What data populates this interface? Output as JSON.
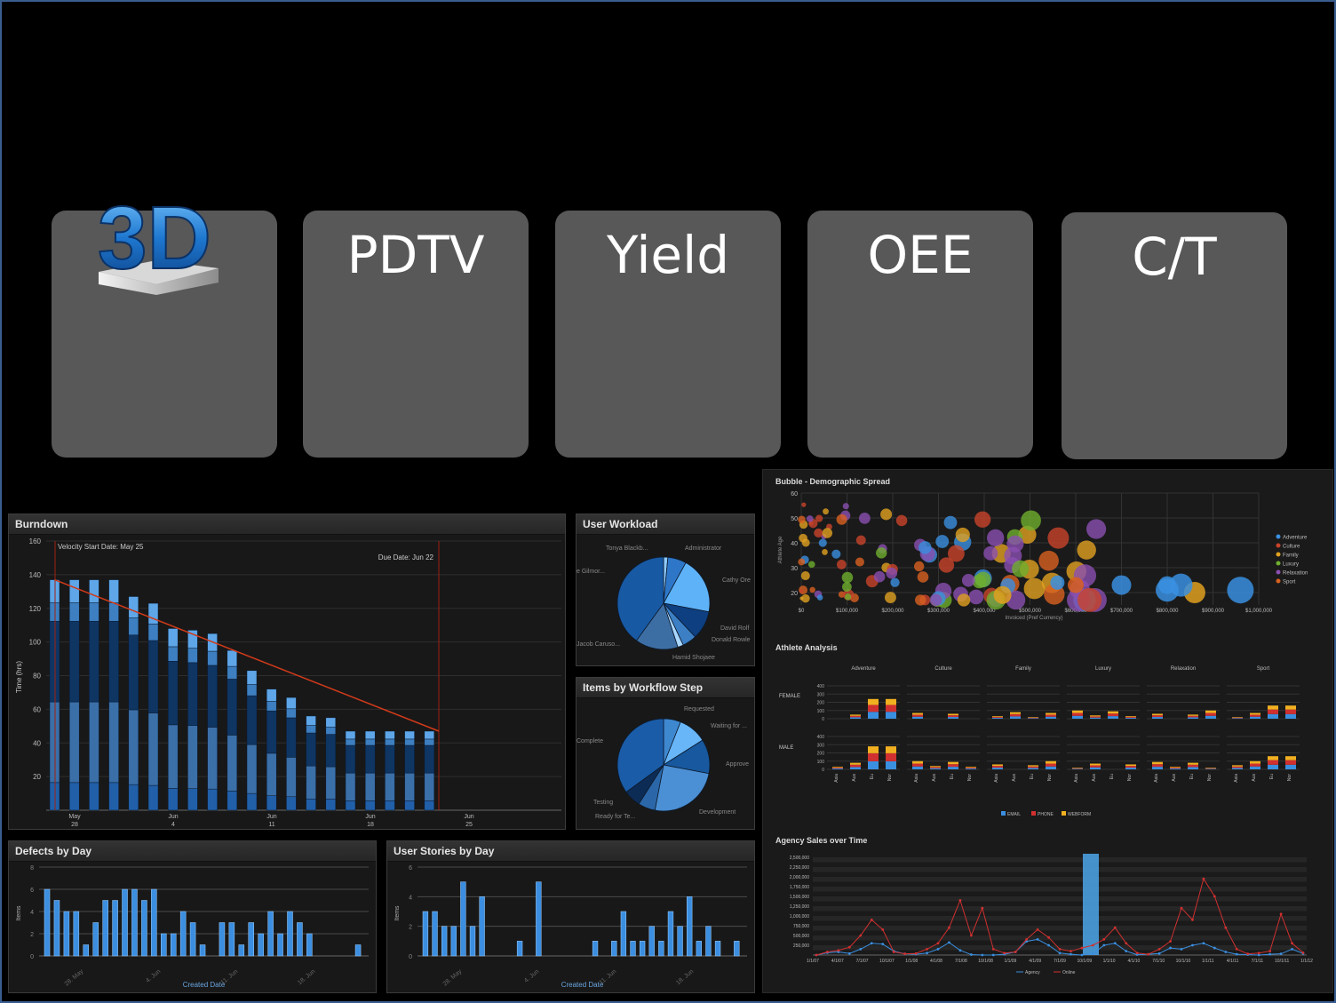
{
  "tiles": [
    {
      "label": "",
      "icon": "3d-logo-icon"
    },
    {
      "label": "PDTV"
    },
    {
      "label": "Yield"
    },
    {
      "label": "OEE"
    },
    {
      "label": "C/T"
    }
  ],
  "logo_text": "3D",
  "colors": {
    "accent": "#4a9fe0",
    "tile": "#585858",
    "frame": "#3a5d8f",
    "trend": "#d03a1a"
  },
  "burndown": {
    "title": "Burndown",
    "ylabel": "Time (hrs)",
    "yticks": [
      "20",
      "40",
      "60",
      "80",
      "100",
      "120",
      "140",
      "160"
    ],
    "xticks": [
      [
        "May",
        "28"
      ],
      [
        "Jun",
        "4"
      ],
      [
        "Jun",
        "11"
      ],
      [
        "Jun",
        "18"
      ],
      [
        "Jun",
        "25"
      ]
    ],
    "annotation_start": "Velocity Start Date: May 25",
    "annotation_due": "Due Date: Jun 22"
  },
  "user_workload": {
    "title": "User Workload",
    "labels": [
      "Tonya Blackb...",
      "Administrator",
      "Cathy Ore",
      "David Rolf",
      "Donald Rowle",
      "Hamid Shojaee",
      "Jacob Caruso...",
      "e Gilmor..."
    ]
  },
  "workflow": {
    "title": "Items by Workflow Step",
    "labels": [
      "Requested",
      "Waiting for ...",
      "Approve",
      "Development",
      "Ready for Te...",
      "Testing",
      "Complete"
    ]
  },
  "defects": {
    "title": "Defects by Day",
    "ylabel": "Items",
    "xlabel": "Created Date",
    "yticks": [
      "0",
      "2",
      "4",
      "6",
      "8"
    ],
    "xticks": [
      "28. May",
      "4. Jun",
      "11. Jun",
      "18. Jun"
    ]
  },
  "stories": {
    "title": "User Stories by Day",
    "ylabel": "Items",
    "xlabel": "Created Date",
    "yticks": [
      "0",
      "2",
      "4",
      "6"
    ],
    "xticks": [
      "28. May",
      "4. Jun",
      "11. Jun",
      "18. Jun"
    ]
  },
  "bubble": {
    "title": "Bubble - Demographic Spread",
    "ylabel": "Athlete Age",
    "xlabel": "Invoiced (Pref Currency)",
    "yticks": [
      "20",
      "30",
      "40",
      "50",
      "60"
    ],
    "xticks": [
      "$0",
      "$100,000",
      "$200,000",
      "$300,000",
      "$400,000",
      "$500,000",
      "$600,000",
      "$700,000",
      "$800,000",
      "$900,000",
      "$1,000,000"
    ],
    "legend": [
      "Adventure",
      "Culture",
      "Family",
      "Luxury",
      "Relaxation",
      "Sport"
    ]
  },
  "athlete": {
    "title": "Athlete Analysis",
    "categories": [
      "Adventure",
      "Culture",
      "Family",
      "Luxury",
      "Relaxation",
      "Sport"
    ],
    "rows": [
      "FEMALE",
      "MALE"
    ],
    "yticks": [
      "0",
      "100",
      "200",
      "300",
      "400"
    ],
    "xticks": [
      "Asia",
      "Aus",
      "Eu",
      "Nor"
    ],
    "legend": [
      "EMAIL",
      "PHONE",
      "WEBFORM"
    ]
  },
  "agency": {
    "title": "Agency Sales over Time",
    "yticks": [
      "250,000",
      "500,000",
      "750,000",
      "1,000,000",
      "1,250,000",
      "1,500,000",
      "1,750,000",
      "2,000,000",
      "2,250,000",
      "2,500,000"
    ],
    "xticks": [
      "1/1/07",
      "4/1/07",
      "7/1/07",
      "10/1/07",
      "1/1/08",
      "4/1/08",
      "7/1/08",
      "10/1/08",
      "1/1/09",
      "4/1/09",
      "7/1/09",
      "10/1/09",
      "1/1/10",
      "4/1/10",
      "7/1/10",
      "10/1/10",
      "1/1/11",
      "4/1/11",
      "7/1/11",
      "10/1/11",
      "1/1/12"
    ],
    "legend": [
      "Agency",
      "Online"
    ]
  },
  "chart_data": [
    {
      "type": "bar",
      "title": "Burndown",
      "ylabel": "Time (hrs)",
      "ylim": [
        0,
        160
      ],
      "values": [
        137,
        137,
        137,
        137,
        127,
        123,
        108,
        107,
        105,
        95,
        83,
        72,
        67,
        56,
        55,
        47,
        47,
        47,
        47,
        47
      ]
    },
    {
      "type": "pie",
      "title": "User Workload",
      "labels": [
        "Tonya Blackb...",
        "Administrator",
        "Cathy Ore",
        "David Rolf",
        "Donald Rowle",
        "Hamid Shojaee",
        "Jacob Caruso...",
        "e Gilmor..."
      ],
      "values": [
        1.5,
        6.5,
        20,
        10,
        5,
        2,
        15,
        40
      ]
    },
    {
      "type": "pie",
      "title": "Items by Workflow Step",
      "labels": [
        "Requested",
        "Waiting for ...",
        "Approve",
        "Development",
        "Ready for Te...",
        "Testing",
        "Complete"
      ],
      "values": [
        6,
        10,
        12,
        25,
        6,
        6,
        35
      ]
    },
    {
      "type": "bar",
      "title": "Defects by Day",
      "xlabel": "Created Date",
      "ylabel": "Items",
      "ylim": [
        0,
        8
      ],
      "values": [
        6,
        5,
        4,
        4,
        1,
        3,
        5,
        5,
        6,
        6,
        5,
        6,
        2,
        2,
        4,
        3,
        1,
        0,
        3,
        3,
        1,
        3,
        2,
        4,
        2,
        4,
        3,
        2,
        0,
        0,
        0,
        0,
        1
      ]
    },
    {
      "type": "bar",
      "title": "User Stories by Day",
      "xlabel": "Created Date",
      "ylabel": "Items",
      "ylim": [
        0,
        6
      ],
      "values": [
        3,
        3,
        2,
        2,
        5,
        2,
        4,
        0,
        0,
        0,
        1,
        0,
        5,
        0,
        0,
        0,
        0,
        0,
        1,
        0,
        1,
        3,
        1,
        1,
        2,
        1,
        3,
        2,
        4,
        1,
        2,
        1,
        0,
        1
      ]
    },
    {
      "type": "scatter",
      "title": "Bubble - Demographic Spread",
      "xlabel": "Invoiced (Pref Currency)",
      "ylabel": "Athlete Age",
      "xlim": [
        0,
        1000000
      ],
      "ylim": [
        15,
        60
      ]
    },
    {
      "type": "bar",
      "title": "Athlete Analysis",
      "ylim": [
        0,
        400
      ],
      "series": [
        "EMAIL",
        "PHONE",
        "WEBFORM"
      ]
    },
    {
      "type": "line",
      "title": "Agency Sales over Time",
      "ylim": [
        0,
        2500000
      ],
      "series": [
        {
          "name": "Agency",
          "values": [
            0,
            60000,
            80000,
            40000,
            150000,
            300000,
            280000,
            100000,
            30000,
            20000,
            50000,
            150000,
            320000,
            120000,
            10000,
            0,
            0,
            20000,
            80000,
            350000,
            400000,
            250000,
            50000,
            20000,
            0,
            30000,
            250000,
            300000,
            100000,
            10000,
            20000,
            40000,
            180000,
            150000,
            250000,
            300000,
            180000,
            80000,
            20000,
            10000,
            0,
            20000,
            30000,
            150000,
            40000
          ]
        },
        {
          "name": "Online",
          "values": [
            0,
            80000,
            120000,
            200000,
            500000,
            900000,
            650000,
            80000,
            30000,
            40000,
            150000,
            300000,
            700000,
            1400000,
            500000,
            1200000,
            150000,
            50000,
            80000,
            400000,
            650000,
            450000,
            150000,
            100000,
            180000,
            250000,
            400000,
            700000,
            300000,
            50000,
            20000,
            150000,
            350000,
            1200000,
            900000,
            1950000,
            1500000,
            700000,
            150000,
            30000,
            50000,
            100000,
            1050000,
            300000,
            60000
          ]
        }
      ]
    }
  ]
}
